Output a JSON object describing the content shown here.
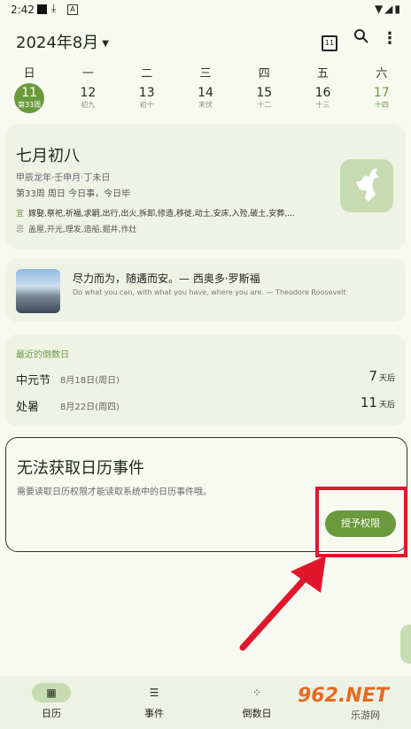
{
  "status_bar": {
    "time": "2:42",
    "icons": "▼◢▮"
  },
  "header": {
    "month": "2024年8月",
    "calendar_day": "11"
  },
  "weekdays": [
    "日",
    "一",
    "二",
    "三",
    "四",
    "五",
    "六"
  ],
  "week": [
    {
      "num": "11",
      "sub": "第33周"
    },
    {
      "num": "12",
      "sub": "初九"
    },
    {
      "num": "13",
      "sub": "初十"
    },
    {
      "num": "14",
      "sub": "末伏"
    },
    {
      "num": "15",
      "sub": "十二"
    },
    {
      "num": "16",
      "sub": "十三"
    },
    {
      "num": "17",
      "sub": "十四"
    }
  ],
  "lunar": {
    "title": "七月初八",
    "ganzhi": "甲辰龙年·壬申月·丁未日",
    "info": "第33周 周日 今日事，今日毕",
    "yi_label": "宜",
    "yi": "嫁娶,祭祀,祈福,求嗣,出行,出火,拆卸,修造,移徙,动土,安床,入殓,破土,安葬,...",
    "ji_label": "忌",
    "ji": "盖屋,开光,理发,造船,掘井,作灶"
  },
  "quote": {
    "zh": "尽力而为，随遇而安。— 西奥多·罗斯福",
    "en": "Do what you can, with what you have, where you are. — Theodore Roosevelt"
  },
  "countdown": {
    "header": "最近的倒数日",
    "items": [
      {
        "name": "中元节",
        "date": "8月18日(周日)",
        "days": "7",
        "unit": "天后"
      },
      {
        "name": "处暑",
        "date": "8月22日(周四)",
        "days": "11",
        "unit": "天后"
      }
    ]
  },
  "permission": {
    "title": "无法获取日历事件",
    "desc": "需要读取日历权限才能读取系统中的日历事件哦。",
    "button": "授予权限"
  },
  "nav": {
    "calendar": "日历",
    "events": "事件",
    "countdown": "倒数日"
  },
  "watermark": {
    "big": "962.NET",
    "small": "乐游网"
  },
  "colors": {
    "accent": "#6b9a3c",
    "highlight": "#e0162b",
    "card": "#eff3e6"
  }
}
